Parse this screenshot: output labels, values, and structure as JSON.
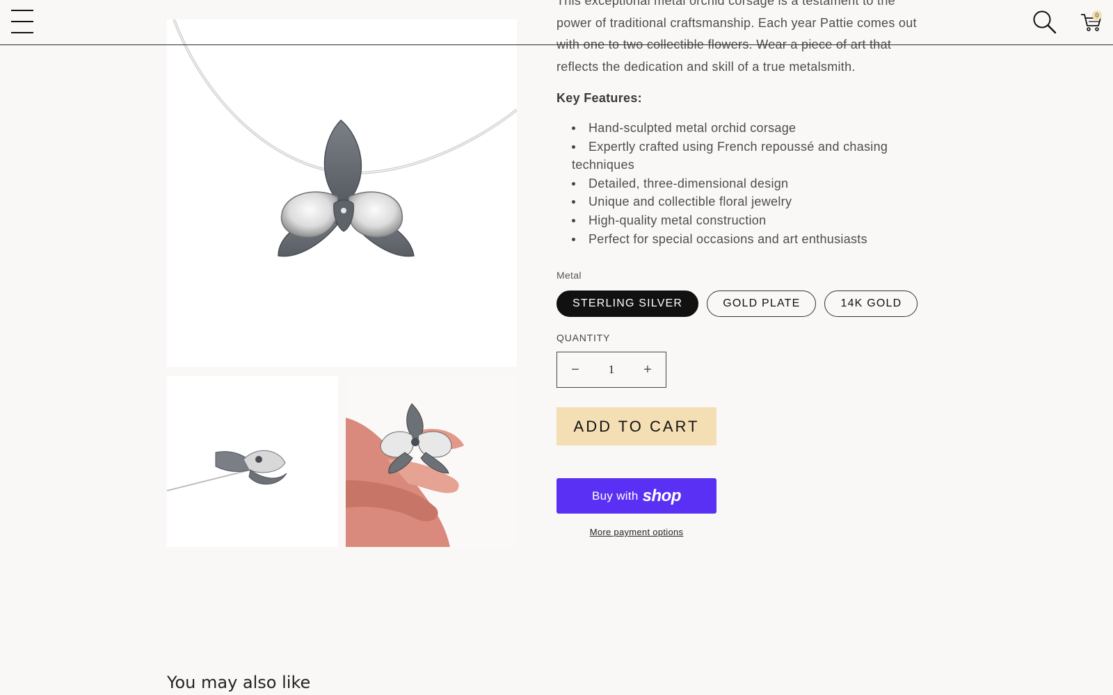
{
  "header": {
    "cart_count": "0"
  },
  "gallery": {
    "main_image_alt": "Sterling silver orchid pendant on neck wire",
    "thumbs": [
      {
        "alt": "Orchid pendant side view"
      },
      {
        "alt": "Orchid corsage held between fingers"
      }
    ]
  },
  "product": {
    "description_lines": [
      "This exceptional metal orchid corsage is a testament to the",
      "power of traditional craftsmanship. Each year Pattie comes out",
      "with one to two collectible flowers. Wear a piece of art that",
      "reflects the dedication and skill of a true metalsmith."
    ],
    "key_features_title": "Key Features:",
    "features": [
      "Hand-sculpted metal orchid corsage",
      "Expertly crafted using French repoussé and chasing",
      "techniques",
      "Detailed, three-dimensional design",
      "Unique and collectible floral jewelry",
      "High-quality metal construction",
      "Perfect for special occasions and art enthusiasts"
    ],
    "metal_label": "Metal",
    "metal_options": [
      "STERLING SILVER",
      "GOLD PLATE",
      "14K GOLD"
    ],
    "metal_selected": "STERLING SILVER",
    "quantity_label": "QUANTITY",
    "quantity_value": "1",
    "minus_symbol": "−",
    "plus_symbol": "+",
    "add_to_cart_label": "ADD TO CART",
    "buy_with_label": "Buy with",
    "shop_logo": "shop",
    "more_payment_label": "More payment options"
  },
  "recommendations": {
    "title": "You may also like"
  },
  "colors": {
    "background": "#f9f8f7",
    "add_to_cart_bg": "#f4dfb4",
    "shop_pay_purple": "#5a31f4",
    "selected_pill": "#111111"
  },
  "icons": {
    "menu": "hamburger-menu-icon",
    "search": "search-icon",
    "cart": "cart-icon"
  }
}
